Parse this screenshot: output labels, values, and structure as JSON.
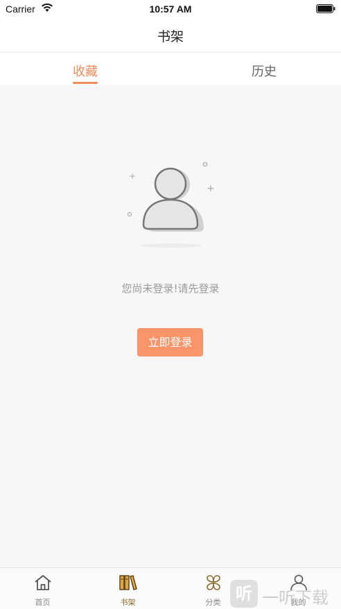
{
  "status_bar": {
    "carrier": "Carrier",
    "time": "10:57 AM",
    "icons": [
      "wifi-icon",
      "battery-icon"
    ]
  },
  "nav": {
    "title": "书架"
  },
  "tabs": [
    {
      "label": "收藏",
      "active": true
    },
    {
      "label": "历史",
      "active": false
    }
  ],
  "empty_state": {
    "icon": "user-avatar-placeholder-icon",
    "message": "您尚未登录!请先登录",
    "login_button": "立即登录"
  },
  "tab_bar": [
    {
      "label": "首页",
      "icon": "home-icon",
      "active": false
    },
    {
      "label": "书架",
      "icon": "bookshelf-icon",
      "active": true
    },
    {
      "label": "分类",
      "icon": "category-icon",
      "active": false
    },
    {
      "label": "我的",
      "icon": "profile-icon",
      "active": false
    }
  ],
  "watermark": {
    "badge": "听",
    "text": "一听下载"
  },
  "colors": {
    "accent": "#f58a5b",
    "button": "#fb9468",
    "background": "#f7f7f7",
    "tab_active": "#8a6a2b"
  }
}
